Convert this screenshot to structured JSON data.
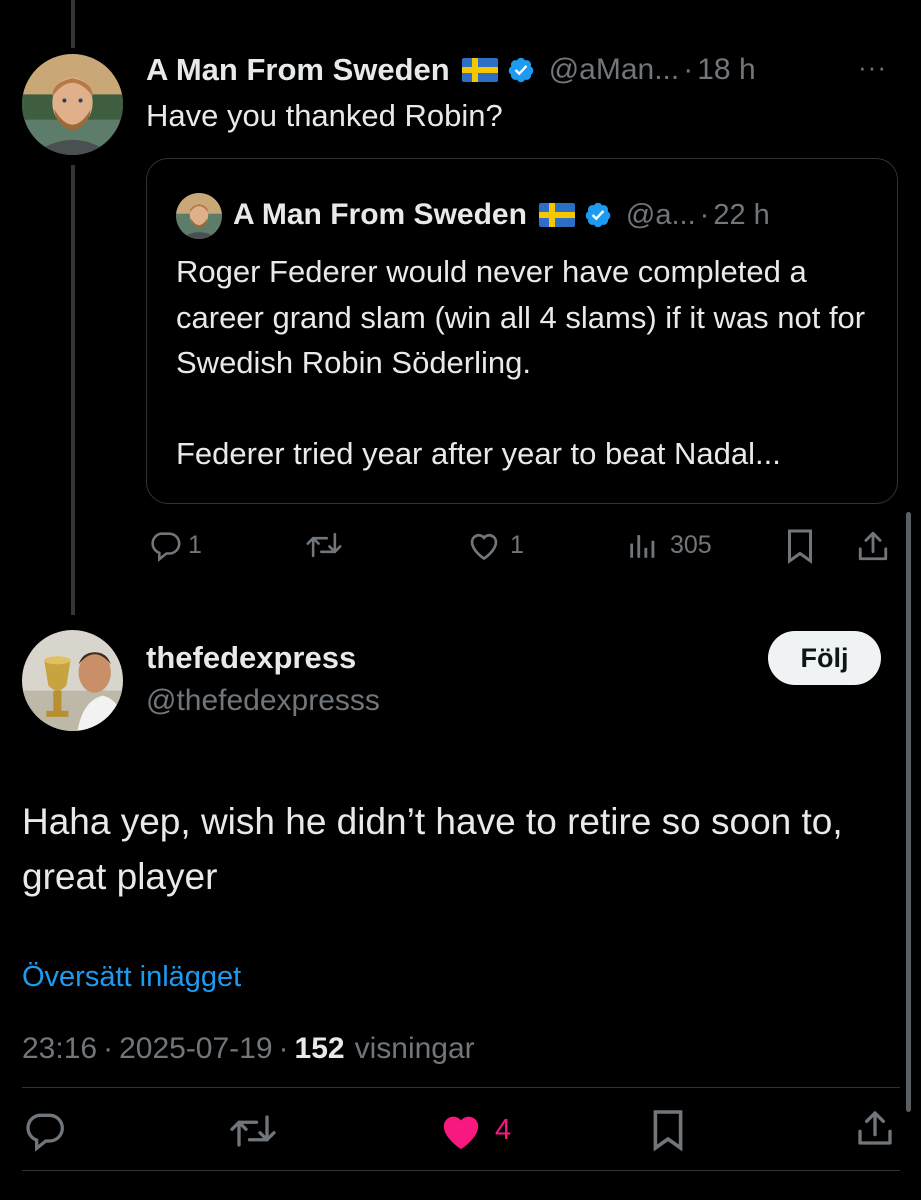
{
  "parent_post": {
    "display_name": "A Man From Sweden",
    "handle": "@aMan...",
    "time": "18 h",
    "text": "Have you thanked Robin?",
    "more_label": "···"
  },
  "quoted_post": {
    "display_name": "A Man From Sweden",
    "handle": "@a...",
    "time": "22 h",
    "text": "Roger Federer would never have completed a career grand slam (win all 4 slams) if it was not for Swedish Robin Söderling.\n\nFederer tried year after year to beat Nadal..."
  },
  "parent_actions": {
    "replies": "1",
    "likes": "1",
    "views": "305",
    "icons": [
      "reply-icon",
      "retweet-icon",
      "heart-icon",
      "views-icon",
      "bookmark-icon",
      "share-icon"
    ]
  },
  "main_post": {
    "display_name": "thefedexpress",
    "handle": "@thefedexpresss",
    "follow_label": "Följ",
    "text": "Haha yep, wish he didn’t have to retire so soon to, great player",
    "translate_label": "Översätt inlägget",
    "time": "23:16",
    "date": "2025-07-19",
    "views_count": "152",
    "views_label": "visningar",
    "separator": "·"
  },
  "main_actions": {
    "likes": "4",
    "icons": [
      "reply-icon",
      "retweet-icon",
      "heart-filled-icon",
      "bookmark-icon",
      "share-icon"
    ]
  },
  "colors": {
    "background": "#000000",
    "text": "#e7e9ea",
    "muted": "#71767b",
    "link": "#1d9bf0",
    "verified": "#1d9bf0",
    "like": "#f91880",
    "border": "#2f3336"
  }
}
